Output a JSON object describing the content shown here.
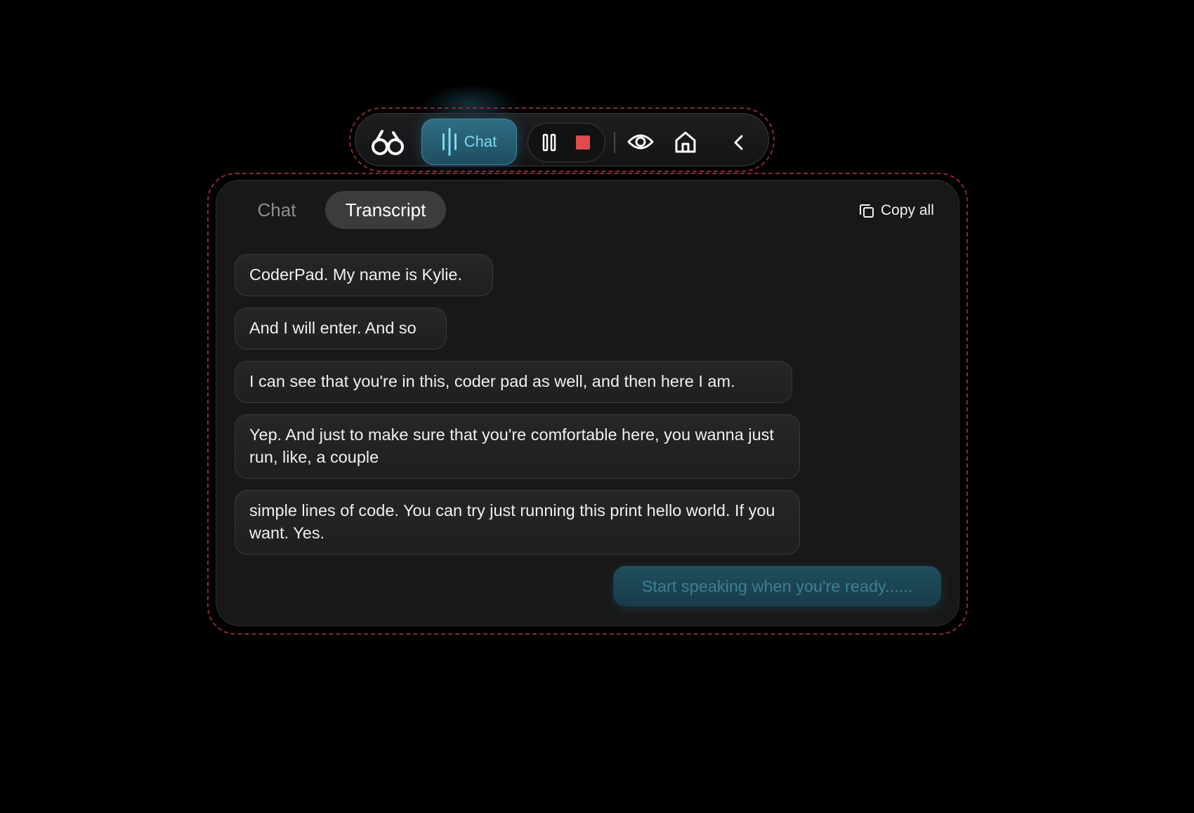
{
  "toolbar": {
    "logo_icon": "glasses-logo-icon",
    "mode_label": "Chat",
    "mode_icon": "audio-bars-icon",
    "pause_icon": "pause-icon",
    "stop_icon": "stop-icon",
    "eye_icon": "eye-icon",
    "home_icon": "home-icon",
    "back_icon": "chevron-left-icon",
    "colors": {
      "accent": "#7fd8f0",
      "stop": "#e14b4b"
    }
  },
  "panel": {
    "tabs": [
      {
        "label": "Chat",
        "active": false
      },
      {
        "label": "Transcript",
        "active": true
      }
    ],
    "copy_all_label": "Copy all",
    "copy_icon": "copy-icon",
    "transcript": [
      "CoderPad. My name is Kylie.",
      "And I will enter. And so",
      "I can see that you're in this, coder pad as well, and then here I am.",
      "Yep. And just to make sure that you're comfortable here, you wanna just run, like, a couple",
      "simple lines of code. You can try just running this print hello world. If you want. Yes."
    ],
    "speak_prompt": "Start speaking when you're ready......"
  }
}
